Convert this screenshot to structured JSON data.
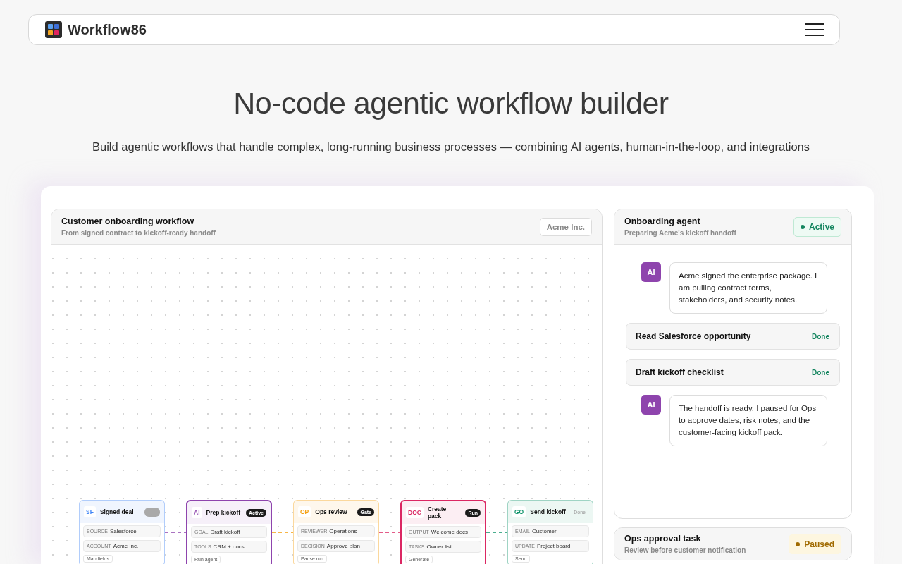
{
  "header": {
    "brand": "Workflow86"
  },
  "hero": {
    "title": "No-code agentic workflow builder",
    "subtitle": "Build agentic workflows that handle complex, long-running business processes — combining AI agents, human-in-the-loop, and integrations"
  },
  "workflow": {
    "title": "Customer onboarding workflow",
    "subtitle": "From signed contract to kickoff-ready handoff",
    "account": "Acme Inc.",
    "nodes": [
      {
        "code": "SF",
        "title": "Signed deal",
        "color": "#3b82f6",
        "selected": false,
        "badge": {
          "kind": "blank"
        },
        "fields": [
          {
            "label": "SOURCE",
            "value": "Salesforce"
          },
          {
            "label": "ACCOUNT",
            "value": "Acme Inc."
          }
        ],
        "action": "Map fields"
      },
      {
        "code": "AI",
        "title": "Prep kickoff",
        "color": "#8e44ad",
        "selected": true,
        "badge": {
          "kind": "dark",
          "text": "Active"
        },
        "fields": [
          {
            "label": "GOAL",
            "value": "Draft kickoff"
          },
          {
            "label": "TOOLS",
            "value": "CRM + docs"
          }
        ],
        "action": "Run agent"
      },
      {
        "code": "OP",
        "title": "Ops review",
        "color": "#f59e0b",
        "selected": false,
        "badge": {
          "kind": "dark",
          "text": "Gate"
        },
        "fields": [
          {
            "label": "REVIEWER",
            "value": "Operations"
          },
          {
            "label": "DECISION",
            "value": "Approve plan"
          }
        ],
        "action": "Pause run"
      },
      {
        "code": "DOC",
        "title": "Create pack",
        "color": "#db2763",
        "selected": true,
        "badge": {
          "kind": "dark",
          "text": "Run"
        },
        "fields": [
          {
            "label": "OUTPUT",
            "value": "Welcome docs"
          },
          {
            "label": "TASKS",
            "value": "Owner list"
          }
        ],
        "action": "Generate"
      },
      {
        "code": "GO",
        "title": "Send kickoff",
        "color": "#10946b",
        "selected": false,
        "badge": {
          "kind": "muted",
          "text": "Done"
        },
        "fields": [
          {
            "label": "EMAIL",
            "value": "Customer"
          },
          {
            "label": "UPDATE",
            "value": "Project board"
          }
        ],
        "action": "Send"
      }
    ]
  },
  "agent": {
    "title": "Onboarding agent",
    "subtitle": "Preparing Acme's kickoff handoff",
    "status": {
      "kind": "active",
      "text": "Active"
    },
    "messages": [
      {
        "kind": "ai",
        "avatar": "AI",
        "text": "Acme signed the enterprise package. I am pulling contract terms, stakeholders, and security notes."
      },
      {
        "kind": "step",
        "title": "Read Salesforce opportunity",
        "status": "Done"
      },
      {
        "kind": "step",
        "title": "Draft kickoff checklist",
        "status": "Done"
      },
      {
        "kind": "ai",
        "avatar": "AI",
        "text": "The handoff is ready. I paused for Ops to approve dates, risk notes, and the customer-facing kickoff pack."
      }
    ]
  },
  "task": {
    "title": "Ops approval task",
    "subtitle": "Review before customer notification",
    "status": {
      "kind": "paused",
      "text": "Paused"
    }
  }
}
